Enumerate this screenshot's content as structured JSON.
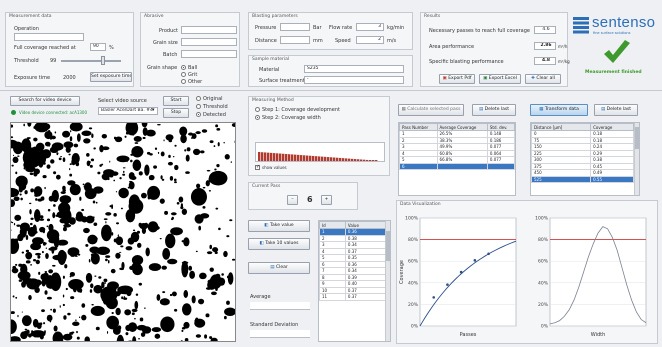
{
  "measurement_data": {
    "title": "Measurement data",
    "operation_label": "Operation",
    "full_coverage_label": "Full coverage reached at",
    "full_coverage_value": "90",
    "full_coverage_unit": "%",
    "threshold_label": "Threshold",
    "threshold_value": "99",
    "exposure_label": "Exposure time",
    "exposure_value": "2000",
    "set_exposure_button": "Set exposure time"
  },
  "abrasive": {
    "title": "Abrasive",
    "product_label": "Product",
    "grain_size_label": "Grain size",
    "batch_label": "Batch",
    "grain_shape_label": "Grain shape",
    "shape_options": [
      "Ball",
      "Grit",
      "Other"
    ]
  },
  "blasting": {
    "title": "Blasting parameters",
    "pressure_label": "Pressure",
    "pressure_unit": "Bar",
    "flow_rate_label": "Flow rate",
    "flow_rate_value": "3",
    "flow_rate_unit": "kg/min",
    "distance_label": "Distance",
    "distance_unit": "mm",
    "speed_label": "Speed",
    "speed_value": "2",
    "speed_unit": "m/s"
  },
  "sample_material": {
    "title": "Sample material",
    "material_label": "Material",
    "material_value": "S235",
    "surface_label": "Surface treatment",
    "surface_value": "-"
  },
  "results": {
    "title": "Results",
    "passes_label": "Necessary passes to reach full coverage",
    "passes_value": "4.6",
    "area_label": "Area performance",
    "area_value": "2.86",
    "area_unit": "m²/h",
    "specific_label": "Specific blasting performance",
    "specific_value": "4.8",
    "specific_unit": "m²/kg",
    "export_pdf": "Export Pdf",
    "export_excel": "Export Excel",
    "clear_all": "Clear all",
    "status_text": "Measurement finished"
  },
  "brand": {
    "name": "sentenso",
    "tagline": "fine surface solutions",
    "accent": "#2d6fb7",
    "check_color": "#3f9a2e"
  },
  "video": {
    "search_button": "Search for video device",
    "source_label": "Select video source",
    "source_value": "Basler Ace/Dart Ba. #4",
    "start_button": "Start",
    "stop_button": "Stop",
    "device_status": "Video device connected: acA1300",
    "view_options": [
      "Original",
      "Threshold",
      "Detected"
    ],
    "view_selected": 2
  },
  "measuring_method": {
    "title": "Measuring Method",
    "options": [
      "Step 1: Coverage development",
      "Step 2: Coverage width"
    ],
    "selected": 1,
    "show_values_label": "show values"
  },
  "current_pass": {
    "title": "Current Pass",
    "value": "6",
    "minus": "–",
    "plus": "+"
  },
  "value_buttons": {
    "take_value": "Take value",
    "take_10_values": "Take 10 values",
    "clear": "Clear"
  },
  "stats": {
    "average_label": "Average",
    "std_label": "Standard Deviation"
  },
  "value_table": {
    "headers": [
      "Id",
      "Value"
    ],
    "rows": [
      [
        "1",
        "0.36"
      ],
      [
        "2",
        "0.38"
      ],
      [
        "3",
        "0.34"
      ],
      [
        "4",
        "0.37"
      ],
      [
        "5",
        "0.35"
      ],
      [
        "6",
        "0.36"
      ],
      [
        "7",
        "0.34"
      ],
      [
        "8",
        "0.39"
      ],
      [
        "9",
        "0.40"
      ],
      [
        "10",
        "0.37"
      ],
      [
        "11",
        "0.37"
      ]
    ],
    "selected_row": 0
  },
  "coverage_table": {
    "select_button": "Calculate selected pass",
    "delete_button": "Delete last",
    "headers": [
      "Pass Number",
      "Average Coverage",
      "Std. dev."
    ],
    "rows": [
      [
        "1",
        "26.5%",
        "0.148"
      ],
      [
        "2",
        "38.3%",
        "0.186"
      ],
      [
        "3",
        "49.9%",
        "0.077"
      ],
      [
        "4",
        "60.8%",
        "0.064"
      ],
      [
        "5",
        "66.8%",
        "0.077"
      ],
      [
        "6",
        "",
        ""
      ]
    ],
    "selected_row": 5
  },
  "width_table": {
    "transform_button": "Transform data",
    "delete_button": "Delete last",
    "headers": [
      "Distance [µm]",
      "Coverage"
    ],
    "rows": [
      [
        "0",
        "0.18"
      ],
      [
        "75",
        "0.18"
      ],
      [
        "150",
        "0.24"
      ],
      [
        "225",
        "0.29"
      ],
      [
        "300",
        "0.38"
      ],
      [
        "375",
        "0.45"
      ],
      [
        "450",
        "0.49"
      ],
      [
        "525",
        "0.55"
      ]
    ],
    "selected_row": 7
  },
  "data_viz": {
    "title": "Data Visualization"
  },
  "chart_data": [
    {
      "type": "line",
      "xlabel": "Passes",
      "ylabel": "Coverage",
      "x": [
        1,
        2,
        3,
        4,
        5
      ],
      "y": [
        26.5,
        38.3,
        49.9,
        60.8,
        66.8
      ],
      "yticks": [
        "0%",
        "20%",
        "40%",
        "60%",
        "80%",
        "100%"
      ],
      "ylim": [
        0,
        100
      ],
      "reference_line": 80,
      "grid": true
    },
    {
      "type": "line",
      "xlabel": "Width",
      "ylabel": "",
      "x": [
        0,
        1,
        2,
        3,
        4,
        5,
        6,
        7,
        8,
        9,
        10,
        11,
        12,
        13,
        14,
        15,
        16,
        17,
        18,
        19,
        20
      ],
      "y": [
        2,
        3,
        5,
        9,
        15,
        24,
        36,
        50,
        64,
        76,
        86,
        92,
        90,
        82,
        70,
        54,
        38,
        24,
        13,
        6,
        3
      ],
      "yticks": [
        "0%",
        "20%",
        "40%",
        "60%",
        "80%",
        "100%"
      ],
      "ylim": [
        0,
        100
      ],
      "reference_line": 80,
      "grid": true
    }
  ]
}
